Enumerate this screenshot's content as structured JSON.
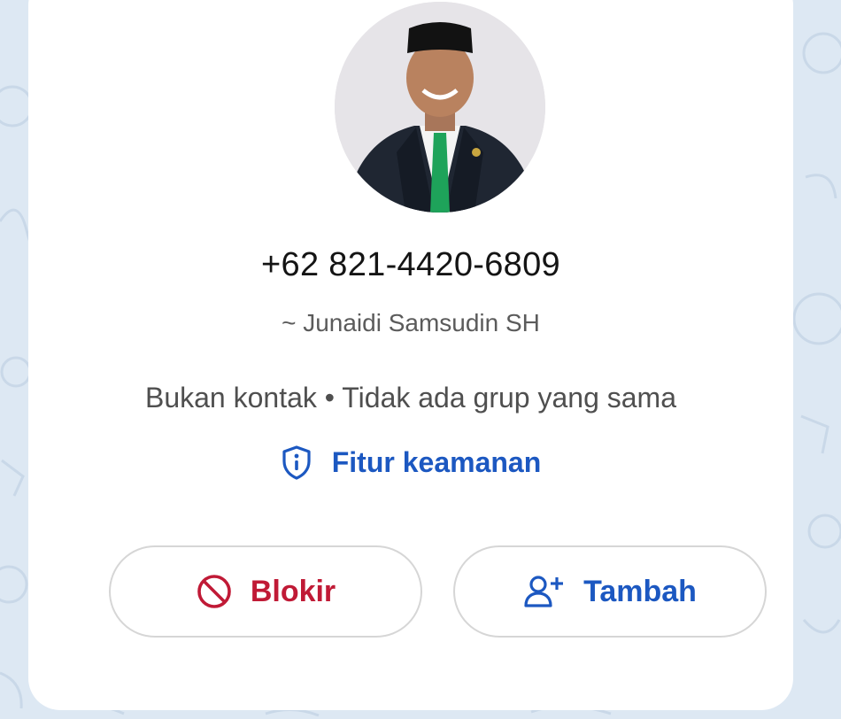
{
  "contact": {
    "phone": "+62 821-4420-6809",
    "push_name": "~ Junaidi Samsudin SH",
    "status": "Bukan kontak • Tidak ada grup yang sama",
    "avatar_icon": "profile-photo"
  },
  "security": {
    "label": "Fitur keamanan",
    "icon": "shield-info-icon"
  },
  "actions": {
    "block": {
      "label": "Blokir",
      "icon": "block-icon",
      "color": "#c01a36"
    },
    "add": {
      "label": "Tambah",
      "icon": "add-person-icon",
      "color": "#1c58c1"
    }
  },
  "colors": {
    "accent": "#1c58c1",
    "danger": "#c01a36",
    "wallpaper": "#dde8f3"
  }
}
